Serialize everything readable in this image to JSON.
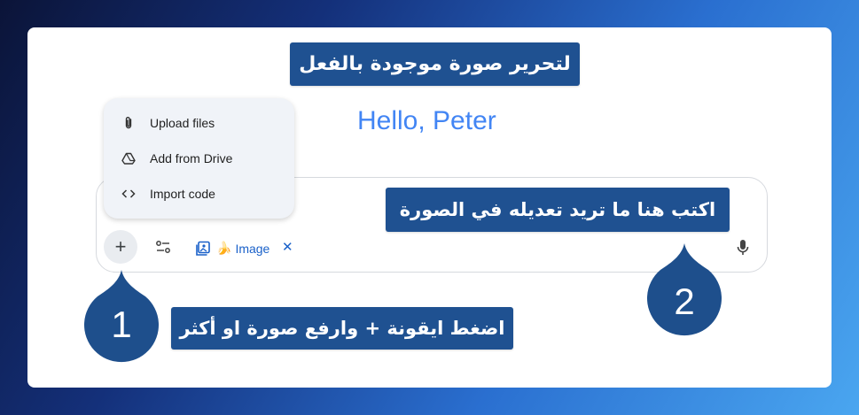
{
  "annotations": {
    "title": "لتحرير صورة موجودة بالفعل",
    "step1_text": "اضغط ايقونة + وارفع صورة او أكثر",
    "step2_text": "اكتب هنا ما تريد تعديله في الصورة",
    "step1_number": "1",
    "step2_number": "2"
  },
  "app": {
    "greeting": "Hello, Peter",
    "plus_label": "+",
    "chip": {
      "label": "Image",
      "emoji": "🍌",
      "close": "✕"
    }
  },
  "upload_menu": {
    "items": [
      {
        "label": "Upload files",
        "icon": "paperclip-icon"
      },
      {
        "label": "Add from Drive",
        "icon": "drive-icon"
      },
      {
        "label": "Import code",
        "icon": "code-icon"
      }
    ]
  },
  "colors": {
    "label_bg": "#1f5191",
    "greeting": "#4285f4",
    "chip_text": "#1a61c9",
    "menu_bg": "#f0f3f8"
  }
}
